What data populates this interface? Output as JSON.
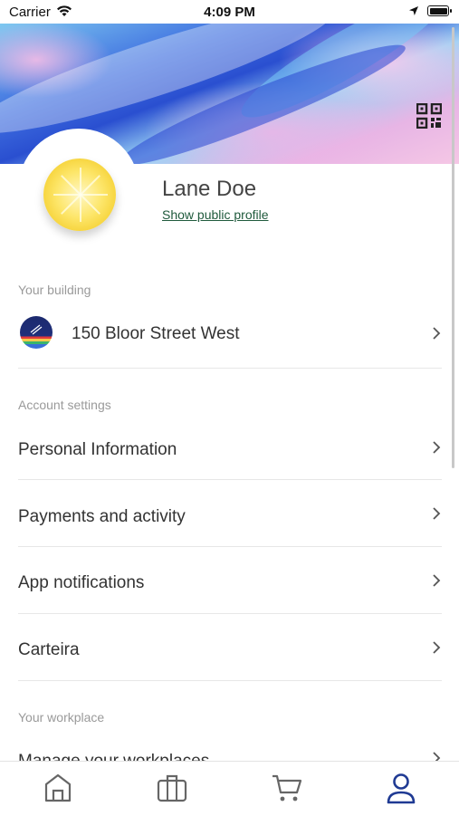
{
  "status_bar": {
    "carrier": "Carrier",
    "time": "4:09 PM"
  },
  "profile": {
    "name": "Lane Doe",
    "public_link": "Show public profile"
  },
  "building_section": {
    "label": "Your building",
    "building_name": "150 Bloor Street West"
  },
  "account_section": {
    "label": "Account settings",
    "items": [
      {
        "label": "Personal Information"
      },
      {
        "label": "Payments and activity"
      },
      {
        "label": "App notifications"
      },
      {
        "label": "Carteira"
      }
    ]
  },
  "workplace_section": {
    "label": "Your workplace",
    "items": [
      {
        "label": "Manage your workplaces"
      }
    ]
  },
  "tabbar": {
    "tabs": [
      {
        "icon": "home-icon"
      },
      {
        "icon": "briefcase-icon"
      },
      {
        "icon": "cart-icon"
      },
      {
        "icon": "profile-icon",
        "active": true
      }
    ]
  },
  "colors": {
    "accent": "#1f3a93",
    "link": "#1f5a3c",
    "inactive_icon": "#666666"
  }
}
